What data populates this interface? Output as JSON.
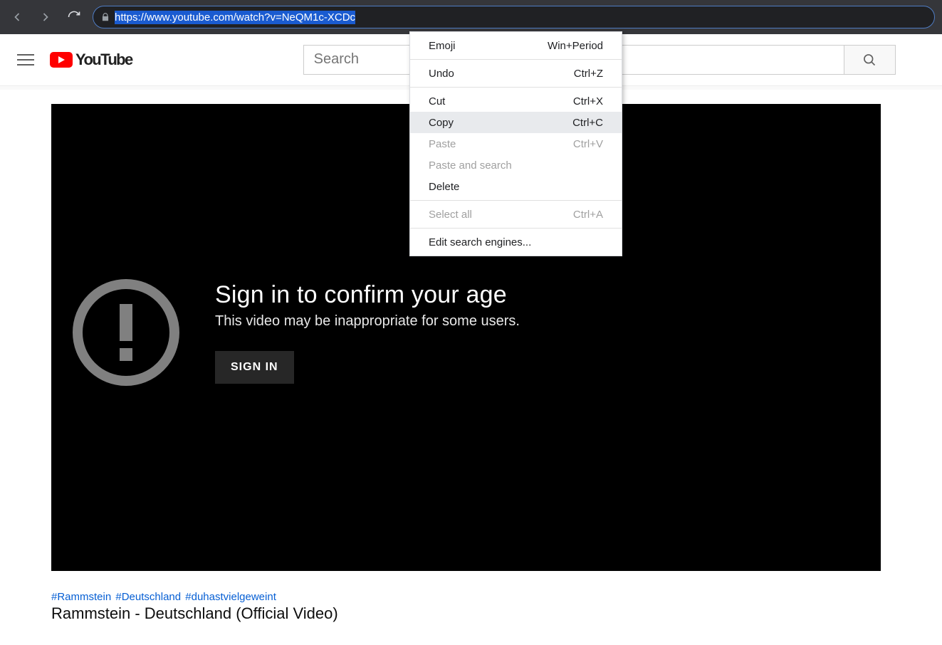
{
  "browser": {
    "url": "https://www.youtube.com/watch?v=NeQM1c-XCDc"
  },
  "youtube": {
    "logo_text": "YouTube",
    "search_placeholder": "Search"
  },
  "age_gate": {
    "heading": "Sign in to confirm your age",
    "sub": "This video may be inappropriate for some users.",
    "button": "SIGN IN"
  },
  "video": {
    "hashtags": [
      "#Rammstein",
      "#Deutschland",
      "#duhastvielgeweint"
    ],
    "title": "Rammstein - Deutschland (Official Video)"
  },
  "context_menu": {
    "groups": [
      [
        {
          "label": "Emoji",
          "shortcut": "Win+Period",
          "disabled": false,
          "hover": false
        }
      ],
      [
        {
          "label": "Undo",
          "shortcut": "Ctrl+Z",
          "disabled": false,
          "hover": false
        }
      ],
      [
        {
          "label": "Cut",
          "shortcut": "Ctrl+X",
          "disabled": false,
          "hover": false
        },
        {
          "label": "Copy",
          "shortcut": "Ctrl+C",
          "disabled": false,
          "hover": true
        },
        {
          "label": "Paste",
          "shortcut": "Ctrl+V",
          "disabled": true,
          "hover": false
        },
        {
          "label": "Paste and search",
          "shortcut": "",
          "disabled": true,
          "hover": false
        },
        {
          "label": "Delete",
          "shortcut": "",
          "disabled": false,
          "hover": false
        }
      ],
      [
        {
          "label": "Select all",
          "shortcut": "Ctrl+A",
          "disabled": true,
          "hover": false
        }
      ],
      [
        {
          "label": "Edit search engines...",
          "shortcut": "",
          "disabled": false,
          "hover": false
        }
      ]
    ]
  }
}
